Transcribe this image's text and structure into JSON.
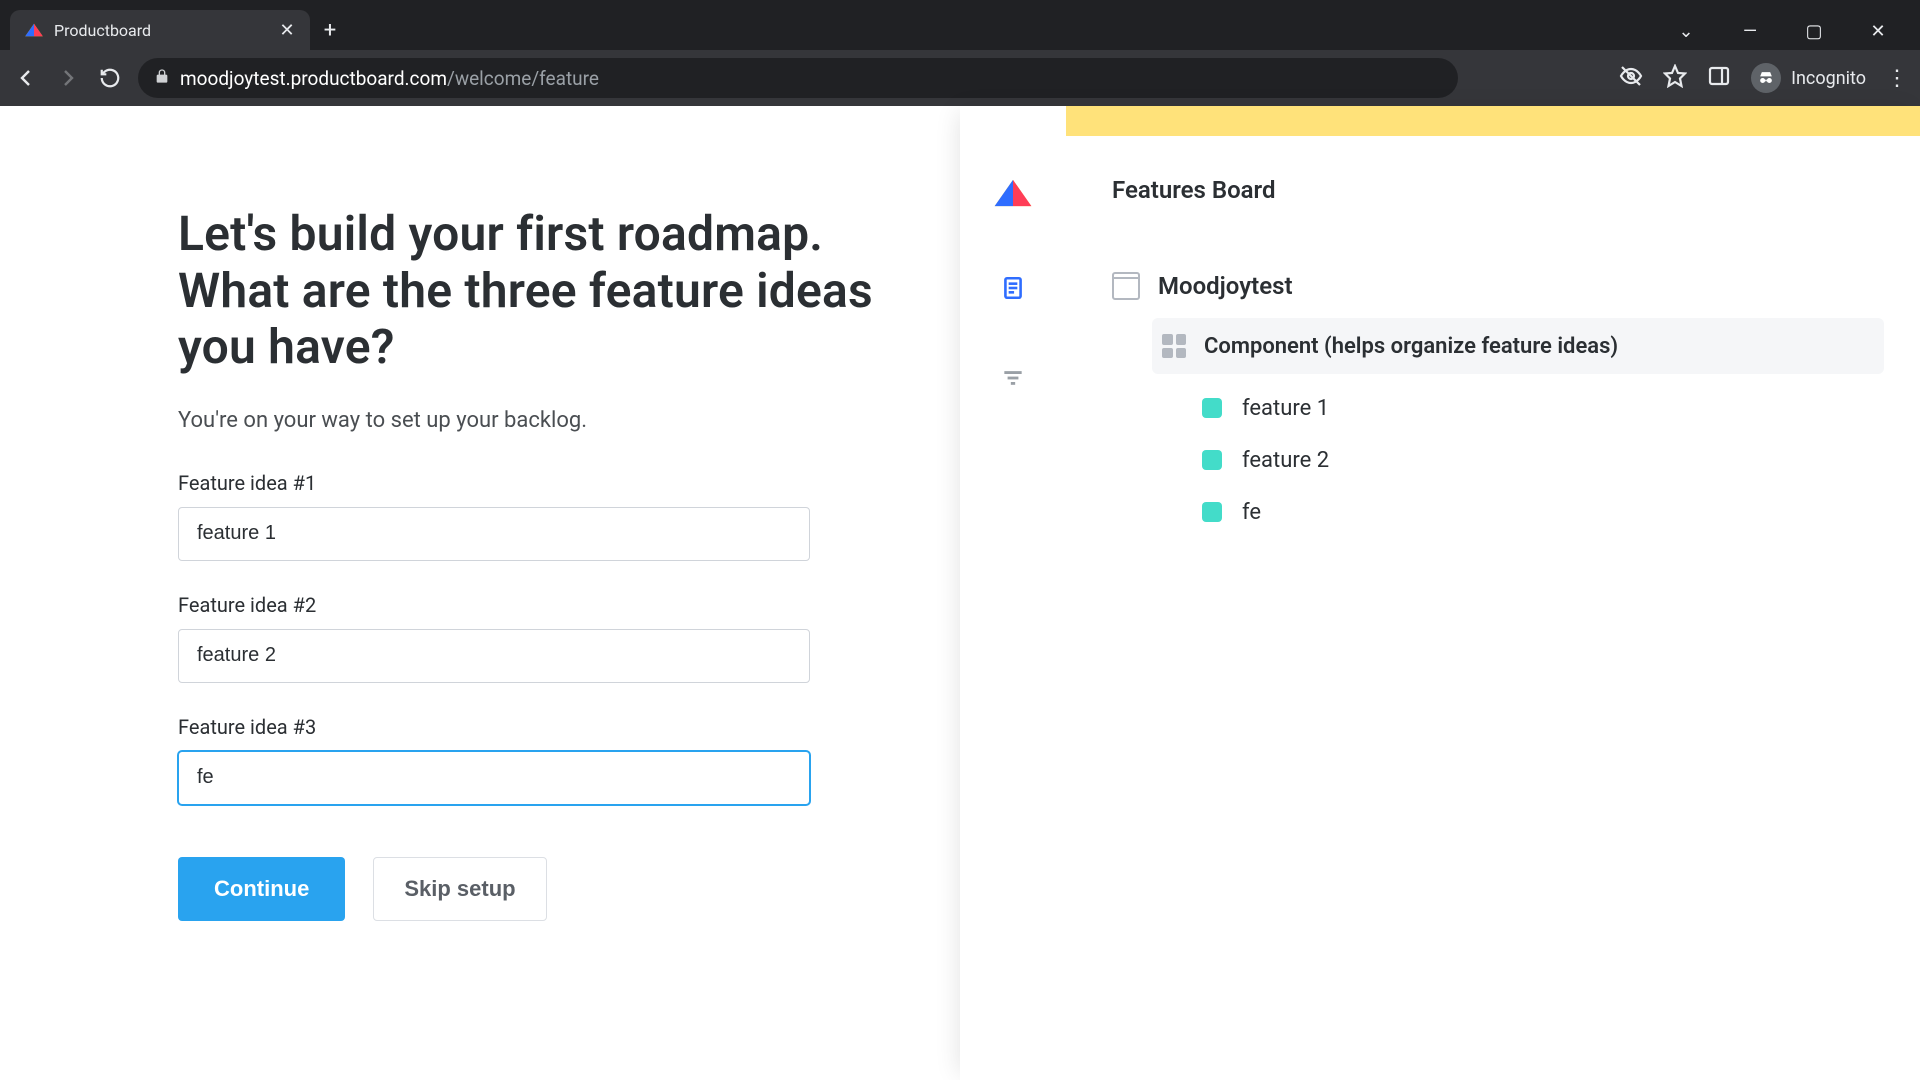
{
  "browser": {
    "tab_title": "Productboard",
    "url_domain": "moodjoytest.productboard.com",
    "url_path": "/welcome/feature",
    "incognito_label": "Incognito"
  },
  "page": {
    "heading_line1": "Let's build your first roadmap.",
    "heading_line2": "What are the three feature ideas you have?",
    "subheading": "You're on your way to set up your backlog.",
    "fields": [
      {
        "label": "Feature idea #1",
        "value": "feature 1"
      },
      {
        "label": "Feature idea #2",
        "value": "feature 2"
      },
      {
        "label": "Feature idea #3",
        "value": "fe"
      }
    ],
    "continue_label": "Continue",
    "skip_label": "Skip setup"
  },
  "board": {
    "title": "Features Board",
    "project": "Moodjoytest",
    "component": "Component (helps organize feature ideas)",
    "features": [
      "feature 1",
      "feature 2",
      "fe"
    ]
  }
}
